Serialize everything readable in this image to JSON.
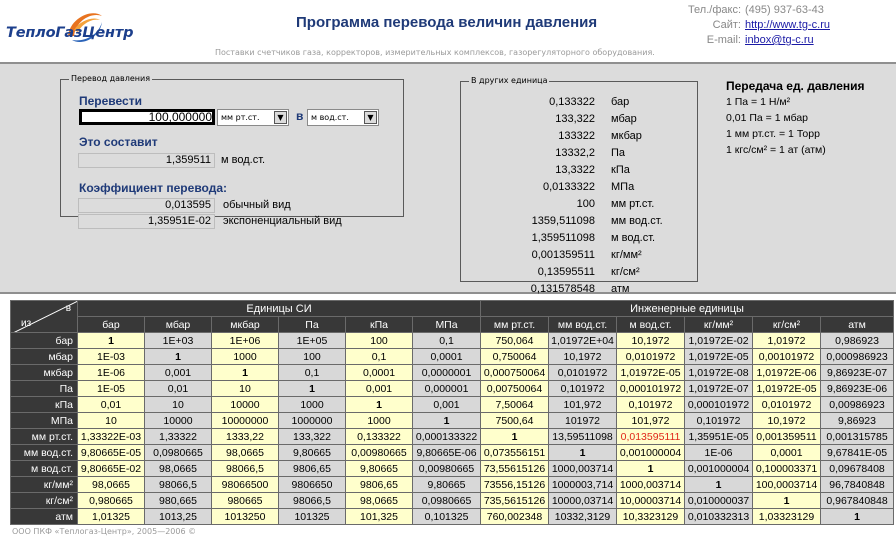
{
  "header": {
    "logo_text": "ТеплоГазЦентр",
    "title": "Программа перевода величин давления",
    "tagline": "Поставки счетчиков газа, корректоров, измерительных комплексов, газорегуляторного оборудования.",
    "phone_label": "Тел./факс:",
    "phone": "(495) 937-63-43",
    "site_label": "Сайт:",
    "site": "http://www.tg-c.ru",
    "email_label": "E-mail:",
    "email": "inbox@tg-c.ru"
  },
  "converter": {
    "legend": "Перевод давления",
    "convert_label": "Перевести",
    "input_value": "100,000000",
    "from_unit": "мм рт.ст.",
    "in_word": "в",
    "to_unit": "м вод.ст.",
    "result_label": "Это составит",
    "result_value": "1,359511",
    "result_unit": "м вод.ст.",
    "coef_label": "Коэффициент перевода:",
    "coef_normal_value": "0,013595",
    "coef_normal_label": "обычный вид",
    "coef_exp_value": "1,35951E-02",
    "coef_exp_label": "экспоненциальный вид"
  },
  "other_units": {
    "legend": "В других единица",
    "rows": [
      {
        "value": "0,133322",
        "unit": "бар"
      },
      {
        "value": "133,322",
        "unit": "мбар"
      },
      {
        "value": "133322",
        "unit": "мкбар"
      },
      {
        "value": "13332,2",
        "unit": "Па"
      },
      {
        "value": "13,3322",
        "unit": "кПа"
      },
      {
        "value": "0,0133322",
        "unit": "МПа"
      },
      {
        "value": "100",
        "unit": "мм рт.ст."
      },
      {
        "value": "1359,511098",
        "unit": "мм вод.ст."
      },
      {
        "value": "1,359511098",
        "unit": "м вод.ст."
      },
      {
        "value": "0,001359511",
        "unit": "кг/мм²"
      },
      {
        "value": "0,13595511",
        "unit": "кг/см²"
      },
      {
        "value": "0,131578548",
        "unit": "атм"
      }
    ]
  },
  "transfer": {
    "title": "Передача ед. давления",
    "lines": [
      "1 Па = 1 Н/м²",
      "0,01 Па = 1 мбар",
      "1 мм рт.ст. = 1 Торр",
      "1 кгс/см² = 1 ат (атм)"
    ]
  },
  "table": {
    "corner_from": "из",
    "corner_to": "в",
    "si_group": "Единицы СИ",
    "eng_group": "Инженерные единицы",
    "columns": [
      "бар",
      "мбар",
      "мкбар",
      "Па",
      "кПа",
      "МПа",
      "мм рт.ст.",
      "мм вод.ст.",
      "м вод.ст.",
      "кг/мм²",
      "кг/см²",
      "атм"
    ],
    "rows": [
      {
        "unit": "бар",
        "cells": [
          "1",
          "1E+03",
          "1E+06",
          "1E+05",
          "100",
          "0,1",
          "750,064",
          "1,01972E+04",
          "10,1972",
          "1,01972E-02",
          "1,01972",
          "0,986923"
        ]
      },
      {
        "unit": "мбар",
        "cells": [
          "1E-03",
          "1",
          "1000",
          "100",
          "0,1",
          "0,0001",
          "0,750064",
          "10,1972",
          "0,0101972",
          "1,01972E-05",
          "0,00101972",
          "0,000986923"
        ]
      },
      {
        "unit": "мкбар",
        "cells": [
          "1E-06",
          "0,001",
          "1",
          "0,1",
          "0,0001",
          "0,0000001",
          "0,000750064",
          "0,0101972",
          "1,01972E-05",
          "1,01972E-08",
          "1,01972E-06",
          "9,86923E-07"
        ]
      },
      {
        "unit": "Па",
        "cells": [
          "1E-05",
          "0,01",
          "10",
          "1",
          "0,001",
          "0,000001",
          "0,00750064",
          "0,101972",
          "0,000101972",
          "1,01972E-07",
          "1,01972E-05",
          "9,86923E-06"
        ]
      },
      {
        "unit": "кПа",
        "cells": [
          "0,01",
          "10",
          "10000",
          "1000",
          "1",
          "0,001",
          "7,50064",
          "101,972",
          "0,101972",
          "0,000101972",
          "0,0101972",
          "0,00986923"
        ]
      },
      {
        "unit": "МПа",
        "cells": [
          "10",
          "10000",
          "10000000",
          "1000000",
          "1000",
          "1",
          "7500,64",
          "101972",
          "101,972",
          "0,101972",
          "10,1972",
          "9,86923"
        ]
      },
      {
        "unit": "мм рт.ст.",
        "cells": [
          "1,33322E-03",
          "1,33322",
          "1333,22",
          "133,322",
          "0,133322",
          "0,000133322",
          "1",
          "13,59511098",
          "0,013595111",
          "1,35951E-05",
          "0,001359511",
          "0,001315785"
        ]
      },
      {
        "unit": "мм вод.ст.",
        "cells": [
          "9,80665E-05",
          "0,0980665",
          "98,0665",
          "9,80665",
          "0,00980665",
          "9,80665E-06",
          "0,073556151",
          "1",
          "0,001000004",
          "1E-06",
          "0,0001",
          "9,67841E-05"
        ]
      },
      {
        "unit": "м вод.ст.",
        "cells": [
          "9,80665E-02",
          "98,0665",
          "98066,5",
          "9806,65",
          "9,80665",
          "0,00980665",
          "73,55615126",
          "1000,003714",
          "1",
          "0,001000004",
          "0,100003371",
          "0,09678408"
        ]
      },
      {
        "unit": "кг/мм²",
        "cells": [
          "98,0665",
          "98066,5",
          "98066500",
          "9806650",
          "9806,65",
          "9,80665",
          "73556,15126",
          "1000003,714",
          "1000,003714",
          "1",
          "100,0003714",
          "96,7840848"
        ]
      },
      {
        "unit": "кг/см²",
        "cells": [
          "0,980665",
          "980,665",
          "980665",
          "98066,5",
          "98,0665",
          "0,0980665",
          "735,5615126",
          "10000,03714",
          "10,00003714",
          "0,010000037",
          "1",
          "0,967840848"
        ]
      },
      {
        "unit": "атм",
        "cells": [
          "1,01325",
          "1013,25",
          "1013250",
          "101325",
          "101,325",
          "0,101325",
          "760,002348",
          "10332,3129",
          "10,3323129",
          "0,010332313",
          "1,03323129",
          "1"
        ]
      }
    ]
  },
  "footer": "ООО ПКФ «Теплогаз-Центр», 2005—2006 ©",
  "colors": {
    "title_blue": "#1f3a78",
    "panel_gray": "#dcdcdc",
    "table_header": "#383838",
    "cell_yellow": "#ffffcc",
    "cell_gray": "#d8d8d8",
    "highlight_red": "#e0281a"
  }
}
